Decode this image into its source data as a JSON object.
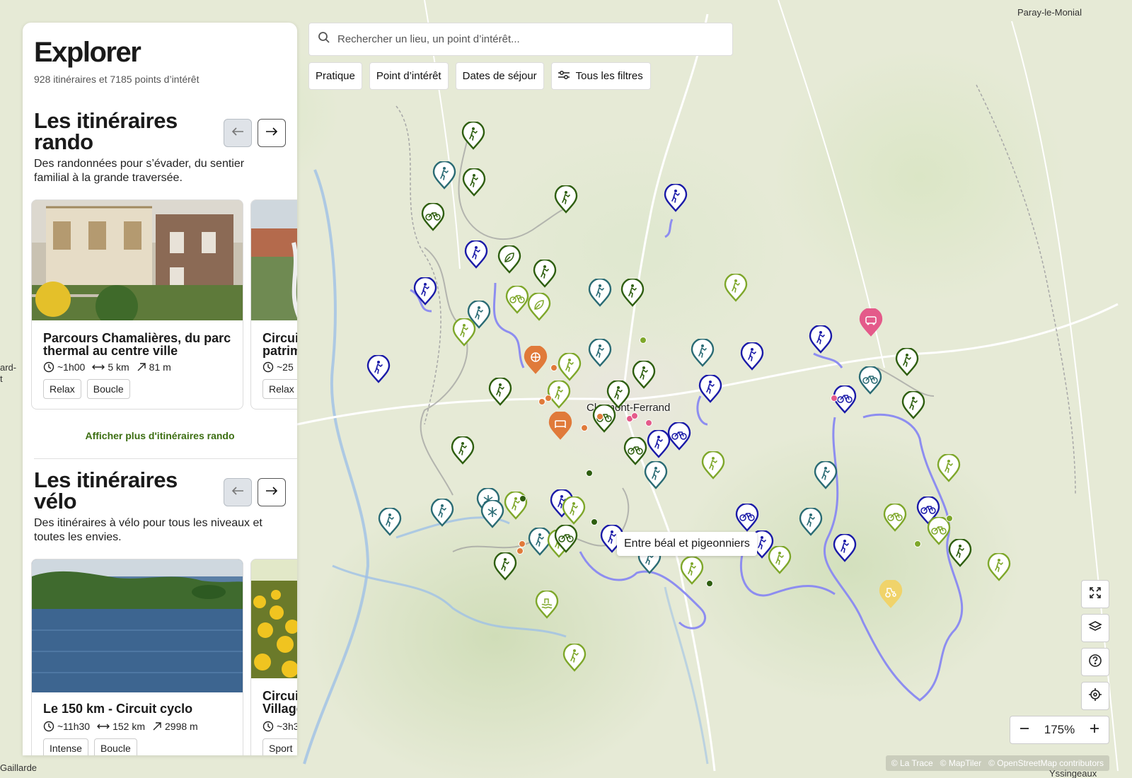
{
  "map": {
    "places": {
      "paray": "Paray-le-Monial",
      "clermont": "Clermont-Ferrand",
      "gaillarde": "Gaillarde",
      "ard": "ard-",
      "t": "t",
      "ussingeaux": "Yssingeaux"
    },
    "tooltip": "Entre béal et pigeonniers",
    "colors": {
      "hike_blue": "#1a1aa8",
      "hike_teal": "#2a6b74",
      "hike_green": "#2e5e0f",
      "bike_lime": "#7ea72a",
      "poi_orange": "#e07a3a",
      "poi_pink": "#e45a8a",
      "route_lilac": "#8d8df0"
    }
  },
  "search": {
    "placeholder": "Rechercher un lieu, un point d’intérêt..."
  },
  "filters": {
    "pratique": "Pratique",
    "poi": "Point d’intérêt",
    "dates": "Dates de séjour",
    "all": "Tous les filtres"
  },
  "controls": {
    "zoom_value": "175%"
  },
  "attribution": {
    "latrace": "© La Trace",
    "maptiler": "© MapTiler",
    "osm": "© OpenStreetMap contributors"
  },
  "panel": {
    "title": "Explorer",
    "subtitle": "928 itinéraires et 7185 points d’intérêt",
    "rando": {
      "title": "Les itinéraires rando",
      "desc": "Des randonnées pour s’évader, du sentier familial à la grande traversée.",
      "more": "Afficher plus d'itinéraires rando",
      "cards": [
        {
          "title": "Parcours Chamalières, du parc thermal au centre ville",
          "duration": "~1h00",
          "distance": "5 km",
          "elevation": "81 m",
          "tags": [
            "Relax",
            "Boucle"
          ]
        },
        {
          "title": "Circuit patrim",
          "duration": "~25",
          "tags": [
            "Relax"
          ]
        }
      ]
    },
    "velo": {
      "title": "Les itinéraires vélo",
      "desc": "Des itinéraires à vélo pour tous les niveaux et toutes les envies.",
      "cards": [
        {
          "title": "Le 150 km - Circuit cyclo",
          "duration": "~11h30",
          "distance": "152 km",
          "elevation": "2998 m",
          "tags": [
            "Intense",
            "Boucle"
          ]
        },
        {
          "title": "Circuit Village",
          "duration": "~3h3",
          "tags": [
            "Sport"
          ]
        }
      ]
    }
  }
}
